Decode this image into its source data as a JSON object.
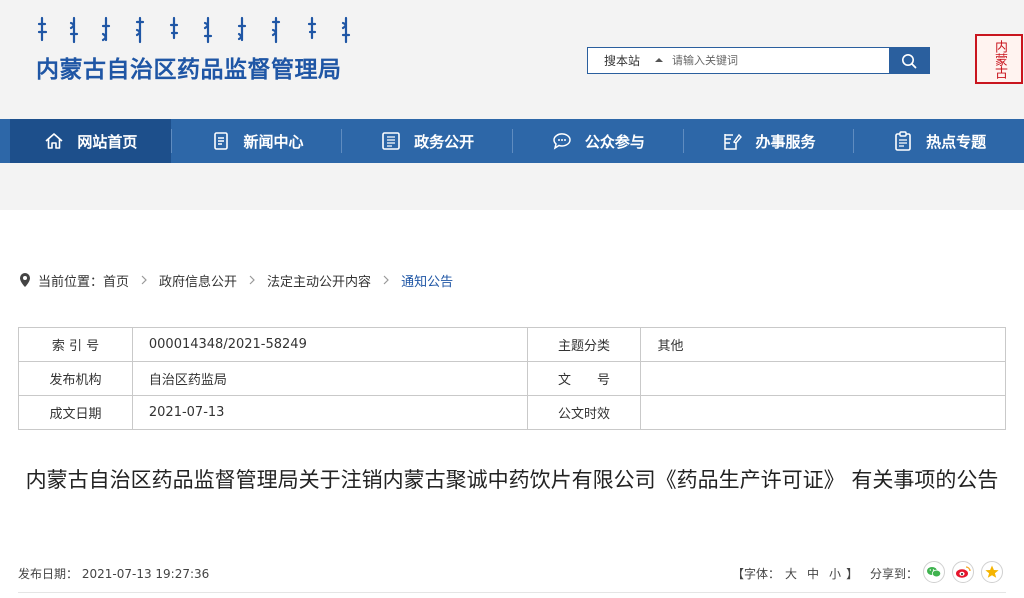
{
  "header": {
    "site_title": "内蒙古自治区药品监督管理局",
    "seal_text": "内蒙古",
    "search": {
      "scope_label": "搜本站",
      "placeholder": "请输入关键词"
    }
  },
  "nav": {
    "items": [
      {
        "label": "网站首页",
        "icon": "home-icon",
        "active": true
      },
      {
        "label": "新闻中心",
        "icon": "news-icon"
      },
      {
        "label": "政务公开",
        "icon": "document-icon"
      },
      {
        "label": "公众参与",
        "icon": "chat-icon"
      },
      {
        "label": "办事服务",
        "icon": "edit-icon"
      },
      {
        "label": "热点专题",
        "icon": "clipboard-icon"
      }
    ]
  },
  "breadcrumb": {
    "prefix": "当前位置：",
    "items": [
      "首页",
      "政府信息公开",
      "法定主动公开内容",
      "通知公告"
    ]
  },
  "info_table": {
    "rows": [
      {
        "k1": "索 引 号",
        "v1": "000014348/2021-58249",
        "k2": "主题分类",
        "v2": "其他"
      },
      {
        "k1": "发布机构",
        "v1": "自治区药监局",
        "k2": "文　　号",
        "v2": ""
      },
      {
        "k1": "成文日期",
        "v1": "2021-07-13",
        "k2": "公文时效",
        "v2": ""
      }
    ]
  },
  "article": {
    "title": "内蒙古自治区药品监督管理局关于注销内蒙古聚诚中药饮片有限公司《药品生产许可证》 有关事项的公告",
    "publish_label": "发布日期：",
    "publish_date": "2021-07-13 19:27:36"
  },
  "tools": {
    "font_prefix": "【字体：",
    "font_large": "大",
    "font_medium": "中",
    "font_small": "小",
    "font_suffix": "】",
    "share_label": "分享到："
  },
  "colors": {
    "brand_blue": "#1f56a5",
    "nav_blue": "#2d67a8",
    "nav_active": "#1d4f8b",
    "seal_red": "#c9151e"
  }
}
